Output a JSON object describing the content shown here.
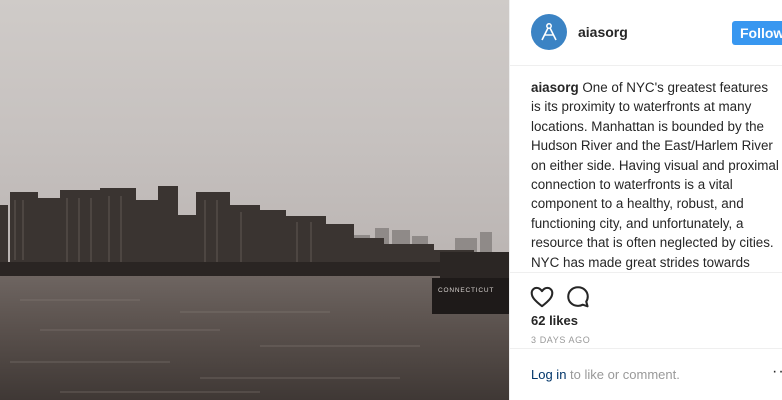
{
  "post": {
    "username": "aiasorg",
    "follow_label": "Follow",
    "caption_user": "aiasorg",
    "caption_text": "One of NYC's greatest features is its proximity to waterfronts at many locations. Manhattan is bounded by the Hudson River and the East/Harlem River on either side. Having visual and proximal connection to waterfronts is a vital component to a healthy, robust, and functioning city, and unfortunately, a resource that is often neglected by cities. NYC has made great strides towards improving the quality of water in its rivers, as well as in upgrading public",
    "likes": "62 likes",
    "timestamp": "3 DAYS AGO",
    "login_link": "Log in",
    "login_suffix": " to like or comment.",
    "more_label": "···",
    "boat_label": "CONNECTICUT"
  },
  "icons": {
    "like": "heart-icon",
    "comment": "comment-icon",
    "avatar": "aia-logo-icon"
  }
}
